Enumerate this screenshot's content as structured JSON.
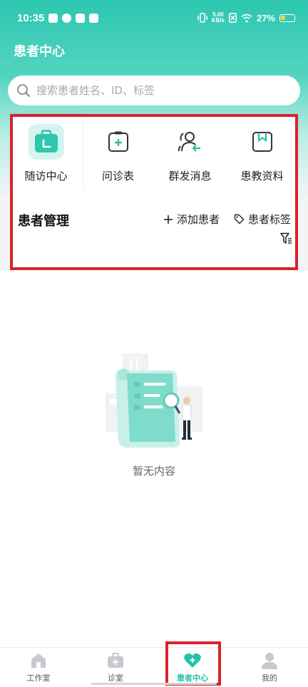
{
  "status_bar": {
    "time": "10:35",
    "net_speed_value": "5.00",
    "net_speed_unit": "KB/s",
    "battery": "27%"
  },
  "page": {
    "title": "患者中心"
  },
  "search": {
    "placeholder": "搜索患者姓名、ID、标签"
  },
  "quick_actions": [
    {
      "label": "随访中心",
      "icon": "calendar-briefcase-icon",
      "active": true
    },
    {
      "label": "问诊表",
      "icon": "clipboard-plus-icon",
      "active": false
    },
    {
      "label": "群发消息",
      "icon": "users-arrow-icon",
      "active": false
    },
    {
      "label": "患教资料",
      "icon": "bookmark-document-icon",
      "active": false
    }
  ],
  "patient_management": {
    "title": "患者管理",
    "add_patient": "添加患者",
    "patient_tags": "患者标签",
    "filter_icon": "filter-icon"
  },
  "empty_state": {
    "text": "暂无内容"
  },
  "bottom_nav": [
    {
      "label": "工作室",
      "icon": "home-icon",
      "active": false
    },
    {
      "label": "诊室",
      "icon": "medical-kit-icon",
      "active": false
    },
    {
      "label": "患者中心",
      "icon": "heart-plus-icon",
      "active": true
    },
    {
      "label": "我的",
      "icon": "person-icon",
      "active": false
    }
  ],
  "colors": {
    "primary": "#26c1ab",
    "highlight_border": "#d9232d"
  }
}
